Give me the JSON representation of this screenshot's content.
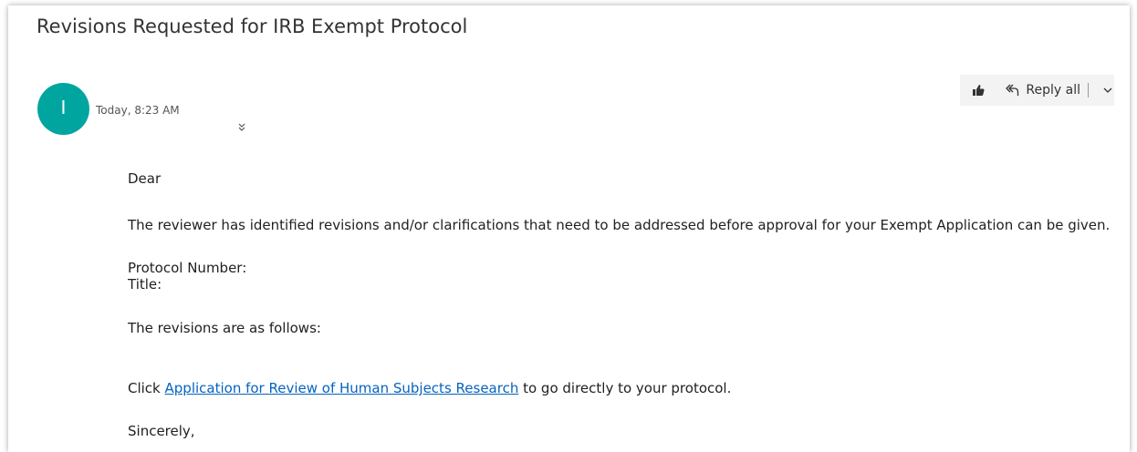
{
  "message": {
    "subject": "Revisions Requested for IRB Exempt Protocol",
    "sender_initial": "I",
    "timestamp": "Today, 8:23 AM",
    "avatar_color": "#00a5a0"
  },
  "actions": {
    "like_icon": "thumbs-up-icon",
    "reply_all_label": "Reply all",
    "reply_icon": "reply-all-icon",
    "dropdown_icon": "chevron-down-icon",
    "expand_icon": "double-chevron-down-icon"
  },
  "body": {
    "greeting": "Dear",
    "paragraph1": "The reviewer has identified revisions and/or clarifications that need to be addressed before approval for your Exempt Application can be given.",
    "protocol_number_label": "Protocol Number:",
    "title_label": "Title:",
    "revisions_intro": "The revisions are as follows:",
    "click_prefix": "Click ",
    "link_text": "Application for Review of Human Subjects Research",
    "click_suffix": " to go directly to your protocol.",
    "closing": "Sincerely,"
  },
  "colors": {
    "link": "#0563c1",
    "action_bar_bg": "#f3f3f3"
  }
}
